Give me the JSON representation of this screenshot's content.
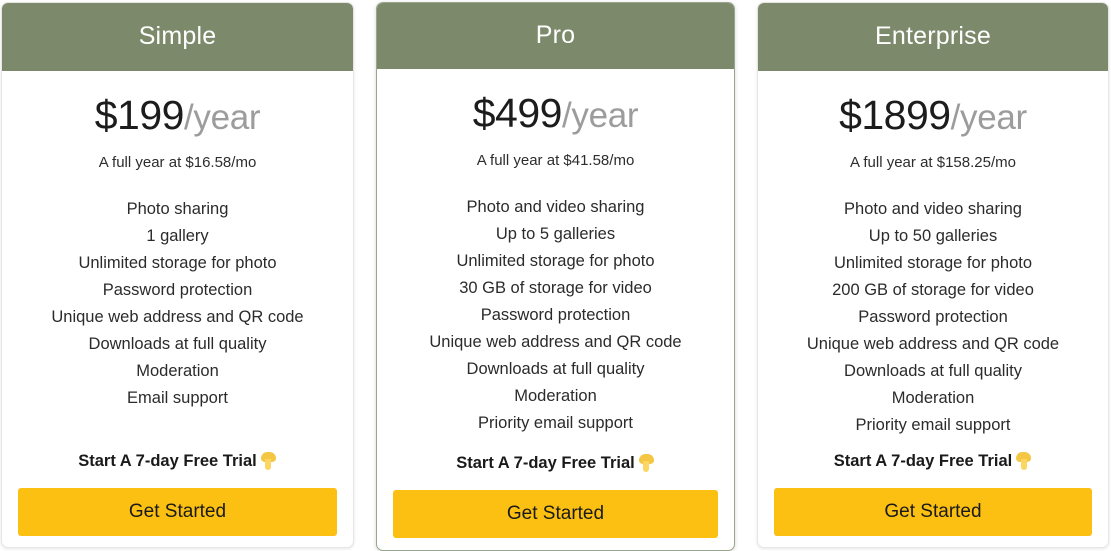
{
  "theme": {
    "header_green": "#7c8a6b",
    "button_yellow": "#fbc011",
    "price_text": "#1c1c1c",
    "period_text": "#9c9c9c",
    "highlight_border": "#9aa58e"
  },
  "plans": [
    {
      "name": "Simple",
      "price_amount": "$199",
      "price_period": "/year",
      "price_sub": "A full year at $16.58/mo",
      "features": [
        "Photo sharing",
        "1 gallery",
        "Unlimited storage for photo",
        "Password protection",
        "Unique web address and QR code",
        "Downloads at full quality",
        "Moderation",
        "Email support"
      ],
      "cta_headline": "Start A 7-day Free Trial",
      "cta_emoji_name": "backhand-index-pointing-down-emoji",
      "button_label": "Get Started"
    },
    {
      "name": "Pro",
      "price_amount": "$499",
      "price_period": "/year",
      "price_sub": "A full year at $41.58/mo",
      "features": [
        "Photo and video sharing",
        "Up to 5 galleries",
        "Unlimited storage for photo",
        "30 GB of storage for video",
        "Password protection",
        "Unique web address and QR code",
        "Downloads at full quality",
        "Moderation",
        "Priority email support"
      ],
      "cta_headline": "Start A 7-day Free Trial",
      "cta_emoji_name": "backhand-index-pointing-down-emoji",
      "button_label": "Get Started"
    },
    {
      "name": "Enterprise",
      "price_amount": "$1899",
      "price_period": "/year",
      "price_sub": "A full year at $158.25/mo",
      "features": [
        "Photo and video sharing",
        "Up to 50 galleries",
        "Unlimited storage for photo",
        "200 GB of storage for video",
        "Password protection",
        "Unique web address and QR code",
        "Downloads at full quality",
        "Moderation",
        "Priority email support"
      ],
      "cta_headline": "Start A 7-day Free Trial",
      "cta_emoji_name": "backhand-index-pointing-down-emoji",
      "button_label": "Get Started"
    }
  ]
}
